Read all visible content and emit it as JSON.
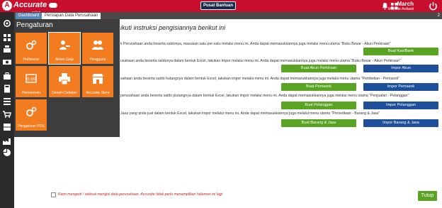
{
  "brand": {
    "name": "Accurate",
    "sub": "online"
  },
  "colors": {
    "topbar": "#c8102e",
    "green": "#5aa423",
    "blue": "#1d4f9b",
    "orange": "#f47c20",
    "panel": "#3d3d3d"
  },
  "topbar": {
    "help_label": "Pusat Bantuan"
  },
  "user": {
    "period": "March",
    "name": "Michelle Ardianti"
  },
  "tabs": {
    "dashboard": "Dashboard",
    "persiapan": "Persiapan Data Perusahaan",
    "count": "2"
  },
  "sidebar_icons": [
    "gear-icon",
    "grid-icon",
    "cash-register-icon",
    "money-icon",
    "briefcase-icon",
    "calculator-icon",
    "list-icon",
    "cart-icon",
    "cabinet-icon",
    "factory-icon",
    "pie-chart-icon"
  ],
  "heading": "ikuti instruksi pengisiannya berikut ini",
  "rows": [
    {
      "text": "k Perusahaan anda beserta saldonya, masukan satu per-satu melalui menu ini. Anda dapat memasukkannya juga melalui menu utama \"Buku Besar - Akun Perkiraan\"",
      "green": "Buat Kas/Bank",
      "blue": ""
    },
    {
      "text": "usahaan anda beserta saldonya dalam bentuk Excel, lakukan impor melalui menu ini. Anda dapat memasukkannya juga melalui menu utama \"Buku Besar - Akun Perkiraan\"",
      "green": "Buat Akun Perkiraan",
      "blue": "Impor Akun"
    },
    {
      "text": "sahaan anda beserta saldo hutangnya dalam bentuk Excel, lakukan impor melalui menu ini. Anda dapat memasukkannya juga melalui menu utama \"Pembelian - Pemasok\"",
      "green": "Buat Pemasok",
      "blue": "Impor Pemasok"
    },
    {
      "text": "perusahaan anda beserta saldo piutangnya dalam bentuk Excel, lakukan impor melalui menu ini. Anda dapat memasukkannya juga melalui menu utama \"Penjualan - Pelanggan\"",
      "green": "Buat Pelanggan",
      "blue": "Impor Pelanggan"
    },
    {
      "text": "Jasa yang anda jual dalam bentuk Excel, lakukan impor melalui menu ini. Anda dapat memasukkannya juga melalui menu utama \"Persediaan - Barang & Jasa\"",
      "green": "Buat Barang & Jasa",
      "blue": "Impor Barang & Jasa"
    }
  ],
  "footer": {
    "checkbox_text": "Kami mengerti / selesai mengisi data perusahaan. Accurate tidak perlu menampilkan halaman ini lagi",
    "close_label": "Tutup"
  },
  "panel": {
    "title": "Pengaturan",
    "tiles": [
      {
        "label": "Preferensi",
        "icon": "gears-icon"
      },
      {
        "label": "Akses Grup",
        "icon": "users-key-icon"
      },
      {
        "label": "Pengguna",
        "icon": "users-icon"
      },
      {
        "label": "Penomoran",
        "icon": "numbering-icon"
      },
      {
        "label": "Desain Cetakan",
        "icon": "printer-icon"
      },
      {
        "label": "Accurate Store",
        "icon": "store-icon"
      },
      {
        "label": "Pengaturan POS",
        "icon": "gears-icon"
      }
    ]
  }
}
